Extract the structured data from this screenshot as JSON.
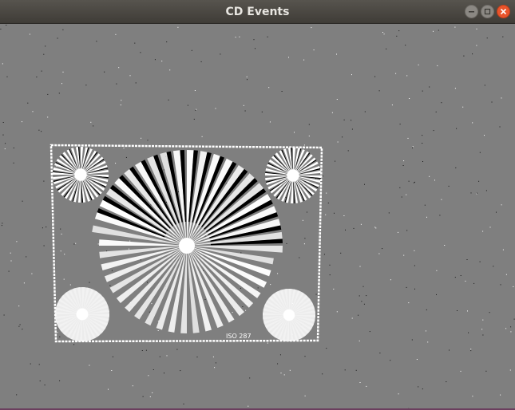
{
  "window": {
    "title": "CD Events"
  },
  "controls": {
    "minimize_icon": "minimize-icon",
    "maximize_icon": "maximize-icon",
    "close_icon": "close-icon"
  },
  "chart_label": "ISO 287",
  "colors": {
    "background": "#7f7f7f",
    "on_event": "#ffffff",
    "off_event": "#000000",
    "close_button": "#e9542b"
  }
}
